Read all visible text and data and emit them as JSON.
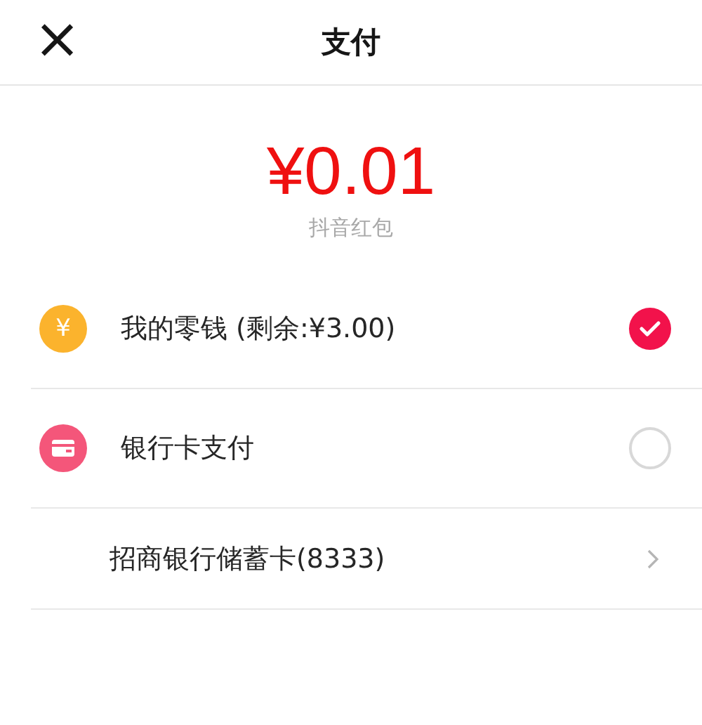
{
  "header": {
    "close": "×",
    "title": "支付"
  },
  "amount": {
    "value": "¥0.01",
    "source": "抖音红包"
  },
  "options": [
    {
      "kind": "wallet",
      "icon_text": "¥",
      "label": "我的零钱 (剩余:¥3.00)",
      "selected": true
    },
    {
      "kind": "card",
      "label": "银行卡支付",
      "selected": false
    },
    {
      "kind": "bank",
      "label": "招商银行储蓄卡(8333)"
    }
  ]
}
